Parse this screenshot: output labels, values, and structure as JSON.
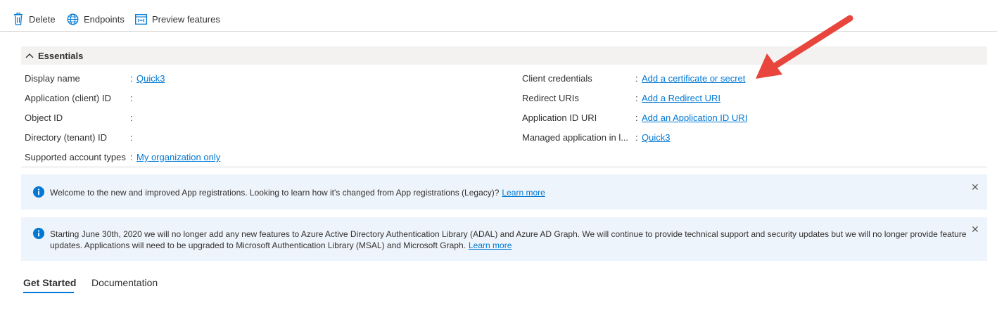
{
  "toolbar": {
    "delete_label": "Delete",
    "endpoints_label": "Endpoints",
    "preview_label": "Preview features"
  },
  "essentials": {
    "title": "Essentials",
    "left": [
      {
        "label": "Display name",
        "value": "Quick3"
      },
      {
        "label": "Application (client) ID",
        "value": ""
      },
      {
        "label": "Object ID",
        "value": ""
      },
      {
        "label": "Directory (tenant) ID",
        "value": ""
      },
      {
        "label": "Supported account types",
        "value": "My organization only"
      }
    ],
    "right": [
      {
        "label": "Client credentials",
        "value": "Add a certificate or secret"
      },
      {
        "label": "Redirect URIs",
        "value": "Add a Redirect URI"
      },
      {
        "label": "Application ID URI",
        "value": "Add an Application ID URI"
      },
      {
        "label": "Managed application in l...",
        "value": "Quick3"
      }
    ],
    "separator": ":"
  },
  "banners": [
    {
      "text": "Welcome to the new and improved App registrations. Looking to learn how it's changed from App registrations (Legacy)?",
      "link": "Learn more"
    },
    {
      "text": "Starting June 30th, 2020 we will no longer add any new features to Azure Active Directory Authentication Library (ADAL) and Azure AD Graph. We will continue to provide technical support and security updates but we will no longer provide feature updates. Applications will need to be upgraded to Microsoft Authentication Library (MSAL) and Microsoft Graph.",
      "link": "Learn more"
    }
  ],
  "close_glyph": "✕",
  "tabs": [
    {
      "label": "Get Started",
      "active": true
    },
    {
      "label": "Documentation",
      "active": false
    }
  ],
  "icons": {
    "delete": "trash-icon",
    "endpoints": "globe-icon",
    "preview": "preview-features-icon",
    "collapse": "chevron-up-icon",
    "info": "info-icon",
    "close": "close-icon",
    "annotation": "red-arrow-annotation"
  },
  "colors": {
    "accent": "#0078d4",
    "essentials_bg": "#f3f2f1",
    "banner_bg": "#eef4fb",
    "annotation": "#e8453c"
  }
}
